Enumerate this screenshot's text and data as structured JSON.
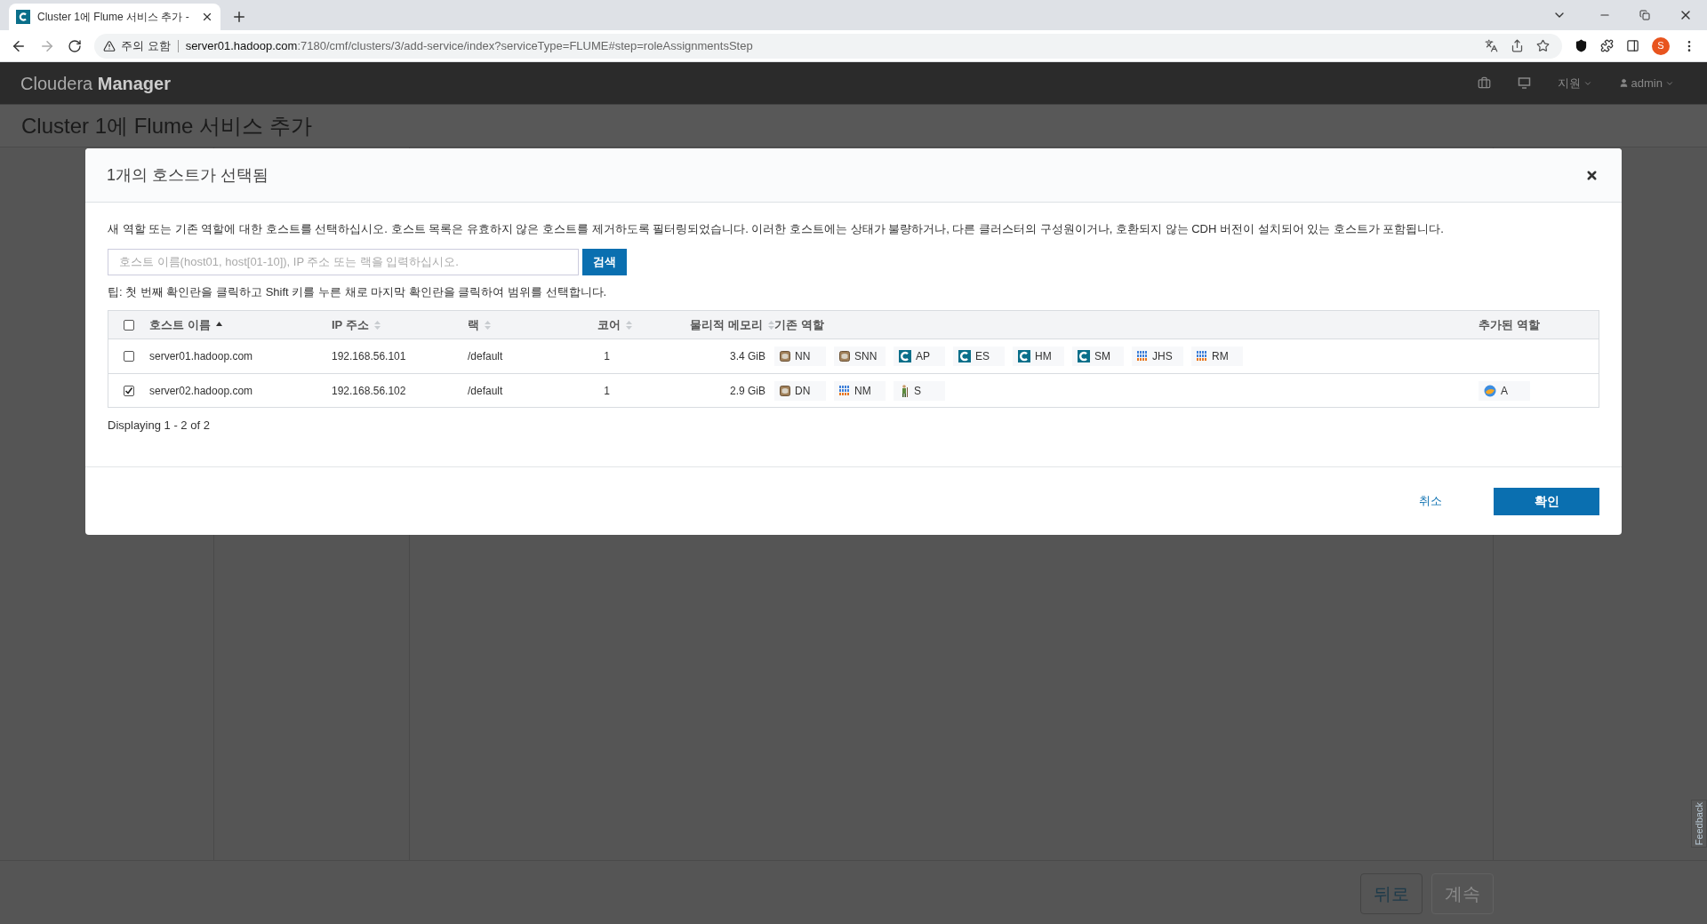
{
  "browser": {
    "tab_title": "Cluster 1에 Flume 서비스 추가 -",
    "warning": "주의 요함",
    "url_host": "server01.hadoop.com",
    "url_rest": ":7180/cmf/clusters/3/add-service/index?serviceType=FLUME#step=roleAssignmentsStep",
    "profile": "S"
  },
  "app": {
    "brand_light": "Cloudera",
    "brand_bold": "Manager",
    "support": "지원",
    "user": "admin",
    "page_title": "Cluster 1에 Flume 서비스 추가"
  },
  "page_buttons": [
    {
      "label": "뒤로",
      "disabled": false
    },
    {
      "label": "계속",
      "disabled": true
    }
  ],
  "feedback": "Feedback",
  "dialog": {
    "title": "1개의 호스트가 선택됨",
    "description": "새 역할 또는 기존 역할에 대한 호스트를 선택하십시오. 호스트 목록은 유효하지 않은 호스트를 제거하도록 필터링되었습니다. 이러한 호스트에는 상태가 불량하거나, 다른 클러스터의 구성원이거나, 호환되지 않는 CDH 버전이 설치되어 있는 호스트가 포함됩니다.",
    "search": {
      "placeholder": "호스트 이름(host01, host[01-10]), IP 주소 또는 랙을 입력하십시오."
    },
    "search_button": "검색",
    "tip": "팁: 첫 번째 확인란을 클릭하고 Shift 키를 누른 채로 마지막 확인란을 클릭하여 범위를 선택합니다.",
    "table": {
      "select_all_checked": false,
      "columns": [
        {
          "label": "호스트 이름",
          "sortable": true,
          "sorted": true
        },
        {
          "label": "IP 주소",
          "sortable": true,
          "sorted": false
        },
        {
          "label": "랙",
          "sortable": true,
          "sorted": false
        },
        {
          "label": "코어",
          "sortable": true,
          "sorted": false
        },
        {
          "label": "물리적 메모리",
          "sortable": true,
          "sorted": false
        },
        {
          "label": "기존 역할"
        },
        {
          "label": "추가된 역할"
        }
      ],
      "rows": [
        {
          "checked": false,
          "host": "server01.hadoop.com",
          "ip": "192.168.56.101",
          "rack": "/default",
          "cores": "1",
          "memory": "3.4 GiB",
          "roles": [
            {
              "label": "NN",
              "kind": "hdfs"
            },
            {
              "label": "SNN",
              "kind": "hdfs"
            },
            {
              "label": "AP",
              "kind": "cloudera"
            },
            {
              "label": "ES",
              "kind": "cloudera"
            },
            {
              "label": "HM",
              "kind": "cloudera"
            },
            {
              "label": "SM",
              "kind": "cloudera"
            },
            {
              "label": "JHS",
              "kind": "yarn"
            },
            {
              "label": "RM",
              "kind": "yarn"
            }
          ],
          "added_roles": []
        },
        {
          "checked": true,
          "host": "server02.hadoop.com",
          "ip": "192.168.56.102",
          "rack": "/default",
          "cores": "1",
          "memory": "2.9 GiB",
          "roles": [
            {
              "label": "DN",
              "kind": "hdfs"
            },
            {
              "label": "NM",
              "kind": "yarn"
            },
            {
              "label": "S",
              "kind": "spark"
            }
          ],
          "added_roles": [
            {
              "label": "A",
              "kind": "flume"
            }
          ]
        }
      ]
    },
    "footer": "Displaying 1 - 2 of 2",
    "cancel": "취소",
    "confirm": "확인"
  }
}
